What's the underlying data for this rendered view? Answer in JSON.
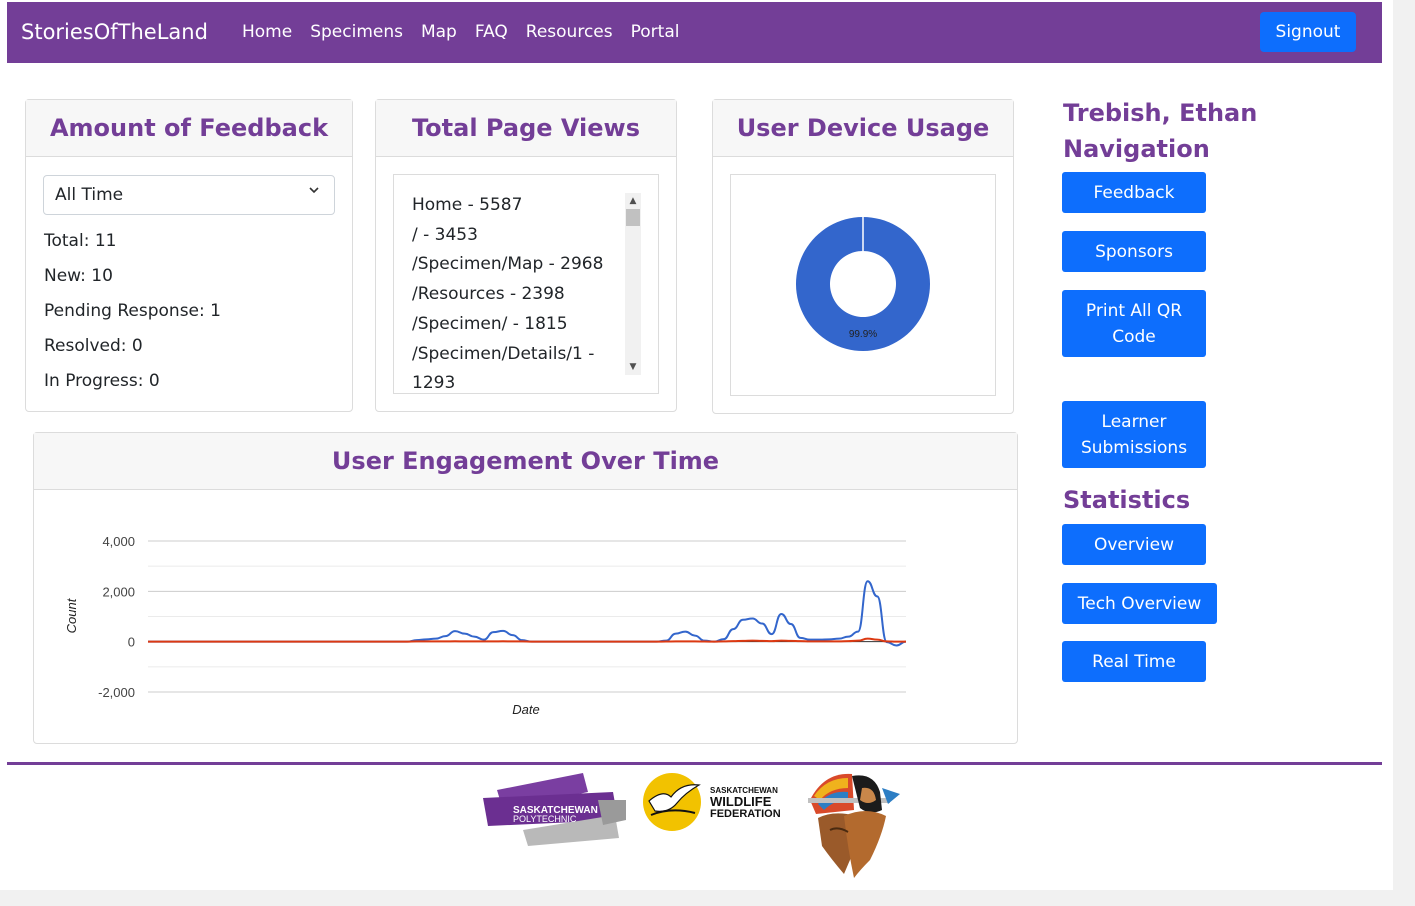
{
  "navbar": {
    "brand": "StoriesOfTheLand",
    "links": [
      "Home",
      "Specimens",
      "Map",
      "FAQ",
      "Resources",
      "Portal"
    ],
    "signout_label": "Signout",
    "color": "#733e97"
  },
  "feedback_card": {
    "title": "Amount of Feedback",
    "filter_value": "All Time",
    "stats": [
      "Total: 11",
      "New: 10",
      "Pending Response: 1",
      "Resolved: 0",
      "In Progress: 0"
    ]
  },
  "page_views_card": {
    "title": "Total Page Views",
    "items": [
      "Home - 5587",
      "/ - 3453",
      "/Specimen/Map - 2968",
      "/Resources - 2398",
      "/Specimen/ - 1815",
      "/Specimen/Details/1 -",
      "1293"
    ]
  },
  "device_card": {
    "title": "User Device Usage",
    "percent_label": "99.9%",
    "slice_fraction": 0.999,
    "color": "#3366cc"
  },
  "engagement_card": {
    "title": "User Engagement Over Time"
  },
  "chart_data": {
    "type": "line",
    "xlabel": "Date",
    "ylabel": "Count",
    "ylim": [
      -2000,
      4000
    ],
    "yticks": [
      "4,000",
      "2,000",
      "0",
      "-2,000"
    ],
    "grid": true,
    "series": [
      {
        "color": "#3366cc",
        "values": [
          0,
          0,
          0,
          0,
          0,
          0,
          0,
          0,
          0,
          0,
          0,
          0,
          0,
          0,
          0,
          0,
          0,
          0,
          0,
          0,
          0,
          0,
          0,
          0,
          0,
          0,
          0,
          0,
          60,
          90,
          120,
          220,
          420,
          320,
          200,
          80,
          380,
          430,
          260,
          60,
          0,
          0,
          0,
          0,
          0,
          0,
          0,
          0,
          0,
          0,
          0,
          0,
          0,
          0,
          40,
          320,
          400,
          240,
          40,
          0,
          100,
          500,
          870,
          920,
          720,
          300,
          1100,
          700,
          150,
          80,
          80,
          90,
          120,
          200,
          400,
          2400,
          1800,
          -20,
          -150,
          0
        ]
      },
      {
        "color": "#dc3912",
        "values": [
          0,
          0,
          0,
          0,
          0,
          0,
          0,
          0,
          0,
          0,
          0,
          0,
          0,
          0,
          0,
          0,
          0,
          0,
          0,
          0,
          0,
          0,
          0,
          0,
          0,
          0,
          0,
          0,
          10,
          10,
          10,
          10,
          15,
          10,
          10,
          10,
          10,
          15,
          10,
          10,
          0,
          0,
          0,
          0,
          0,
          0,
          0,
          0,
          0,
          0,
          0,
          0,
          0,
          0,
          5,
          10,
          10,
          10,
          5,
          0,
          10,
          20,
          30,
          40,
          30,
          20,
          40,
          30,
          20,
          10,
          10,
          10,
          10,
          20,
          40,
          120,
          80,
          10,
          0,
          0
        ]
      }
    ]
  },
  "sidebar": {
    "user_name": "Trebish, Ethan",
    "navigation_heading": "Navigation",
    "navigation_buttons": [
      "Feedback",
      "Sponsors",
      "Print All QR Code",
      "Learner Submissions"
    ],
    "statistics_heading": "Statistics",
    "statistics_buttons": [
      "Overview",
      "Tech Overview",
      "Real Time"
    ]
  },
  "footer": {
    "logo_polytech_line1": "SASKATCHEWAN",
    "logo_polytech_line2": "POLYTECHNIC",
    "logo_wildlife_line1": "SASKATCHEWAN",
    "logo_wildlife_line2": "WILDLIFE",
    "logo_wildlife_line3": "FEDERATION"
  }
}
